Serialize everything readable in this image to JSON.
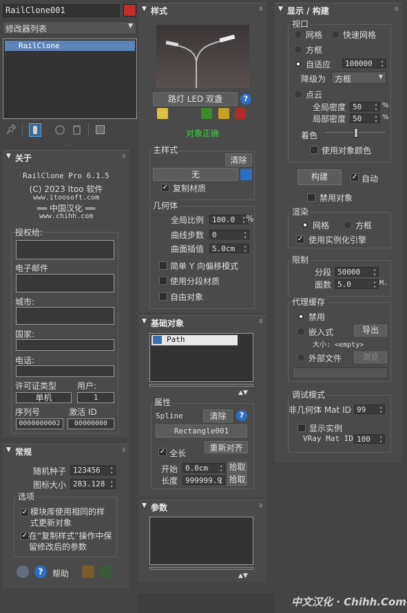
{
  "left": {
    "object_name": "RailClone001",
    "object_color": "#c42b2b",
    "modifier_list": "修改器列表",
    "stack_item": "RailClone",
    "about": {
      "header": "关于",
      "product": "RailClone Pro 6.1.5",
      "copyright": "(C) 2023 Itoo 软件",
      "website": "www.itoosoft.com",
      "hanhua": "══ 中国汉化 ══",
      "hanhua_site": "www.chihh.com",
      "licensed_to": "授权给:",
      "email": "电子邮件",
      "city": "城市:",
      "country": "国家:",
      "phone": "电话:",
      "license_type_label": "许可证类型",
      "users_label": "用户:",
      "license_type": "单机",
      "users": "1",
      "serial_label": "序列号",
      "activation_label": "激活 ID",
      "serial": "0000000002",
      "activation": "00000000"
    },
    "general": {
      "header": "常规",
      "seed_label": "随机种子",
      "seed": "123456",
      "icon_size_label": "图标大小",
      "icon_size": "283.128",
      "options_label": "选项",
      "opt1": "模块库使用相同的样式更新对象",
      "opt2": "在“复制样式”操作中保留修改后的参数",
      "help": "帮助"
    }
  },
  "middle": {
    "style": {
      "header": "样式",
      "style_name": "路灯 LED 双盏",
      "status": "对象正确",
      "main_style": "主样式",
      "clear": "清除",
      "none": "无",
      "copy_material": "复制材质"
    },
    "geometry": {
      "header": "几何体",
      "global_scale_label": "全局比例",
      "global_scale": "100.0",
      "percent": "%",
      "curve_steps_label": "曲线步数",
      "curve_steps": "0",
      "surface_interp_label": "曲面插值",
      "surface_interp": "5.0cm",
      "simple_y": "简单 Y 向偏移模式",
      "segment_mat": "使用分段材质",
      "free_object": "自由对象"
    },
    "base": {
      "header": "基础对象",
      "item": "Path",
      "props_label": "属性",
      "spline_label": "Spline",
      "clear": "清除",
      "spline_name": "Rectangle001",
      "full_length": "全长",
      "realign": "重新对齐",
      "start_label": "开始",
      "start": "0.0cm",
      "length_label": "长度",
      "length": "999999.9",
      "pick": "拾取"
    },
    "params": {
      "header": "参数"
    }
  },
  "right": {
    "header": "显示 / 构建",
    "viewport": {
      "label": "视口",
      "mesh": "网格",
      "fast_mesh": "快速网格",
      "box": "方框",
      "adaptive": "自适应",
      "adaptive_value": "100000",
      "degrade_label": "降级为",
      "degrade_value": "方框",
      "pointcloud": "点云",
      "global_density_label": "全局密度",
      "global_density": "50",
      "local_density_label": "局部密度",
      "local_density": "50",
      "percent": "%",
      "color_label": "着色",
      "use_obj_color": "使用对象颜色"
    },
    "build": "构建",
    "auto": "自动",
    "disable_obj": "禁用对象",
    "render": {
      "label": "渲染",
      "mesh": "网格",
      "box": "方框",
      "instancing": "使用实例化引擎"
    },
    "limits": {
      "label": "限制",
      "segments_label": "分段",
      "segments": "50000",
      "faces_label": "面数",
      "faces": "5.0",
      "faces_unit": "M."
    },
    "proxy": {
      "label": "代理缓存",
      "disabled": "禁用",
      "embedded": "嵌入式",
      "export": "导出",
      "size_label": "大小: <empty>",
      "external": "外部文件",
      "browse": "浏览"
    },
    "debug": {
      "label": "调试模式",
      "nongeo_label": "非几何体 Mat ID",
      "nongeo": "99",
      "show_instances": "显示实例",
      "vray_label": "VRay Mat ID",
      "vray": "100"
    }
  },
  "watermark": "中文汉化 · Chihh.Com"
}
